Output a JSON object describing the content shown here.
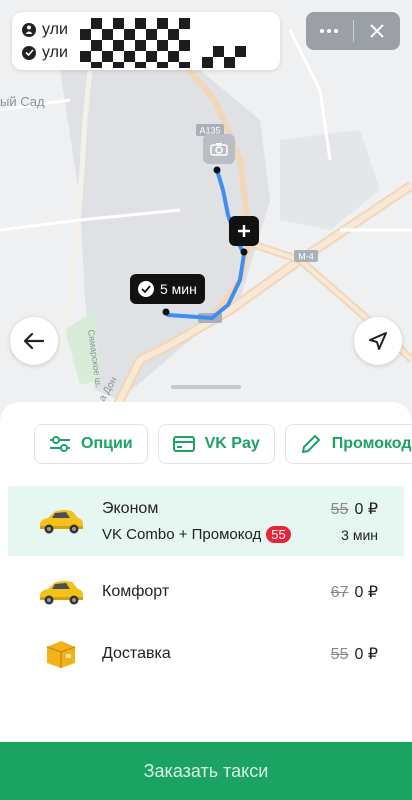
{
  "address": {
    "from_label": "ули",
    "to_label": "ули"
  },
  "window": {
    "more_icon": "more-dots-icon",
    "close_icon": "close-icon"
  },
  "map": {
    "labels": {
      "road1": "A135",
      "road2": "M-4",
      "district": "ый Сад",
      "street1": "Сямарское ш.",
      "street2": "а Дон"
    },
    "eta_badge": "5 мин"
  },
  "chips": [
    {
      "label": "Опции",
      "icon": "sliders-icon"
    },
    {
      "label": "VK Pay",
      "icon": "card-icon"
    },
    {
      "label": "Промокод",
      "icon": "pencil-icon"
    }
  ],
  "tariffs": [
    {
      "name": "Эконом",
      "subtitle": "VK Combo + Промокод",
      "badge": "55",
      "old_price": "55",
      "price": "0 ₽",
      "eta": "3 мин",
      "selected": true
    },
    {
      "name": "Комфорт",
      "old_price": "67",
      "price": "0 ₽"
    },
    {
      "name": "Доставка",
      "old_price": "55",
      "price": "0 ₽"
    }
  ],
  "order_button": "Заказать такси",
  "colors": {
    "accent": "#1aa363",
    "selected_bg": "#e6f6f0",
    "route": "#3d8ef0",
    "badge_red": "#e5263a"
  }
}
